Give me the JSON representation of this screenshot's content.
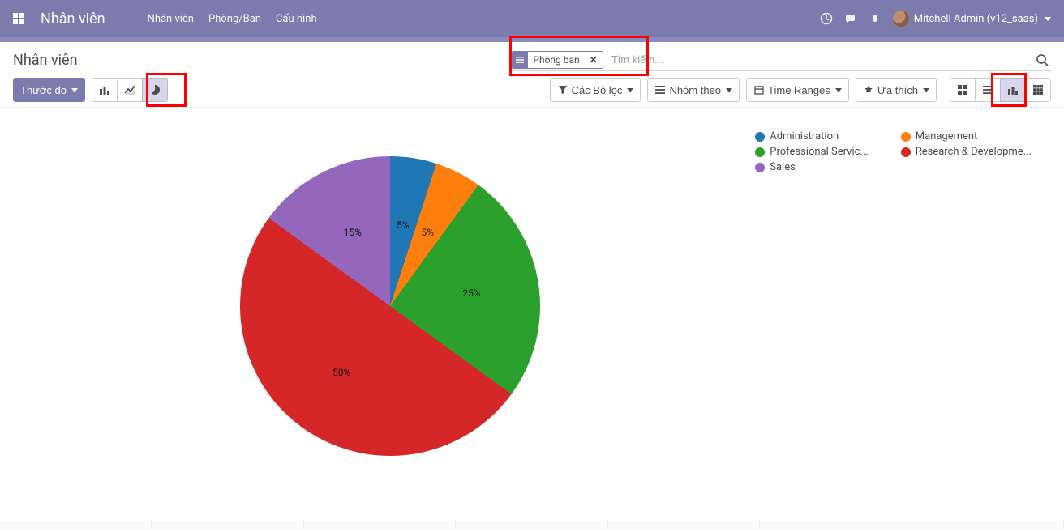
{
  "navbar": {
    "app_title": "Nhân viên",
    "menu": [
      "Nhân viên",
      "Phòng/Ban",
      "Cấu hình"
    ],
    "user_label": "Mitchell Admin (v12_saas)"
  },
  "breadcrumb": "Nhân viên",
  "search": {
    "placeholder": "Tìm kiếm...",
    "facet_label": "Phòng ban"
  },
  "toolbar": {
    "measure_label": "Thước đo",
    "filters_label": "Các Bộ lọc",
    "groupby_label": "Nhóm theo",
    "timeranges_label": "Time Ranges",
    "favorites_label": "Ưa thích"
  },
  "legend": {
    "items": [
      {
        "label": "Administration",
        "color": "#1f77b4"
      },
      {
        "label": "Management",
        "color": "#ff7f0e"
      },
      {
        "label": "Professional Servic...",
        "color": "#2ca02c"
      },
      {
        "label": "Research & Developme...",
        "color": "#d62728"
      },
      {
        "label": "Sales",
        "color": "#9467bd"
      }
    ]
  },
  "chart_data": {
    "type": "pie",
    "title": "",
    "series": [
      {
        "name": "Administration",
        "value": 5,
        "percent_label": "5%",
        "color": "#1f77b4"
      },
      {
        "name": "Management",
        "value": 5,
        "percent_label": "5%",
        "color": "#ff7f0e"
      },
      {
        "name": "Professional Services",
        "value": 25,
        "percent_label": "25%",
        "color": "#2ca02c"
      },
      {
        "name": "Research & Development",
        "value": 50,
        "percent_label": "50%",
        "color": "#d62728"
      },
      {
        "name": "Sales",
        "value": 15,
        "percent_label": "15%",
        "color": "#9467bd"
      }
    ]
  }
}
